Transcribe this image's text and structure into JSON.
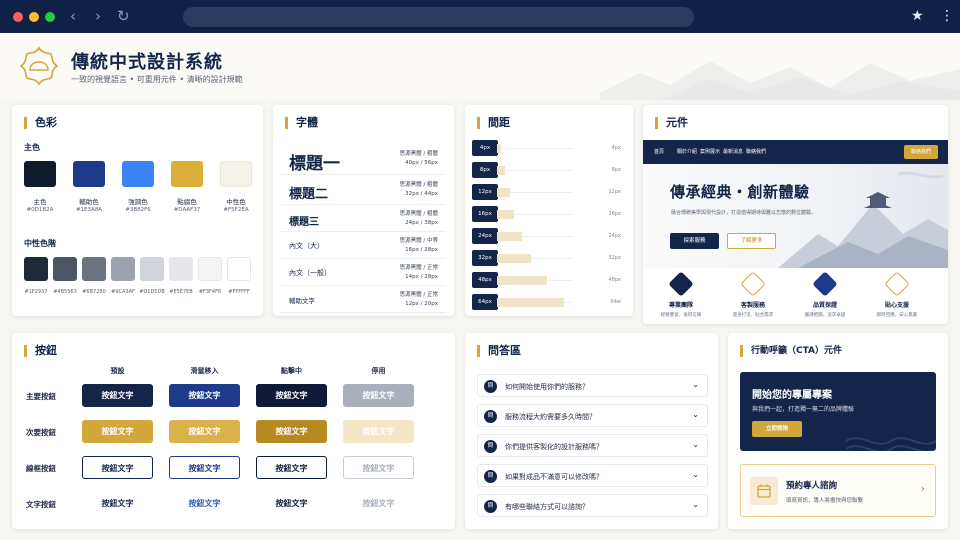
{
  "header": {
    "title": "傳統中式設計系統",
    "subtitle": "一致的視覺語言 • 可重用元件 • 清晰的設計規範"
  },
  "colors": {
    "title": "色彩",
    "primary_label": "主色",
    "primary": [
      {
        "name": "主色",
        "hex": "#0D1B2A"
      },
      {
        "name": "輔助色",
        "hex": "#1E3A8A"
      },
      {
        "name": "強調色",
        "hex": "#3B82F6"
      },
      {
        "name": "點綴色",
        "hex": "#DAAF37"
      },
      {
        "name": "中性色",
        "hex": "#F5F2EA"
      }
    ],
    "neutral_label": "中性色階",
    "neutrals": [
      "#1F2937",
      "#4B5563",
      "#6B7280",
      "#9CA3AF",
      "#D1D5DB",
      "#E5E7EB",
      "#F3F4F6",
      "#FFFFFF"
    ]
  },
  "typography": {
    "title": "字體",
    "rows": [
      {
        "sample": "標題一",
        "font": "思源黑體 / 粗體",
        "size": "40px / 56px"
      },
      {
        "sample": "標題二",
        "font": "思源黑體 / 粗體",
        "size": "32px / 44px"
      },
      {
        "sample": "標題三",
        "font": "思源黑體 / 粗體",
        "size": "24px / 38px"
      },
      {
        "sample": "內文（大）",
        "font": "思源黑體 / 中等",
        "size": "16px / 28px"
      },
      {
        "sample": "內文（一般）",
        "font": "思源黑體 / 正常",
        "size": "14px / 28px"
      },
      {
        "sample": "輔助文字",
        "font": "思源黑體 / 正常",
        "size": "12px / 20px"
      }
    ]
  },
  "spacing": {
    "title": "間距",
    "values": [
      4,
      8,
      12,
      16,
      24,
      32,
      48,
      64
    ],
    "labels": [
      "4px",
      "8px",
      "12px",
      "16px",
      "24px",
      "32px",
      "48px",
      "64px"
    ],
    "right_labels": [
      "4px",
      "8px",
      "12px",
      "16px",
      "24px",
      "32px",
      "48px",
      "64w"
    ]
  },
  "components": {
    "title": "元件",
    "nav_items": [
      "首頁",
      "關於介紹",
      "案例展示",
      "最新消息",
      "聯絡我們"
    ],
    "nav_button": "聯絡我們",
    "hero_title": "傳承經典・創新體驗",
    "hero_text": "融合傳統美學與現代設計，打造值得期待與難以忘懷的數位體驗。",
    "hero_btn_primary": "探索服務",
    "hero_btn_secondary": "了解更多",
    "features": [
      {
        "title": "專業團隊",
        "desc": "經驗豐富，值得信賴"
      },
      {
        "title": "客製服務",
        "desc": "量身打造，貼合需求"
      },
      {
        "title": "品質保證",
        "desc": "嚴謹把關，追求卓越"
      },
      {
        "title": "貼心支援",
        "desc": "即時回應，安心無憂"
      }
    ]
  },
  "buttons": {
    "title": "按鈕",
    "columns": [
      "預設",
      "滑鼠移入",
      "點擊中",
      "停用"
    ],
    "rows": [
      "主要按鈕",
      "次要按鈕",
      "線框按鈕",
      "文字按鈕"
    ],
    "label": "按鈕文字"
  },
  "faq": {
    "title": "問答區",
    "badge": "問",
    "items": [
      "如何開始使用你們的服務？",
      "服務流程大約需要多久時間？",
      "你們提供客製化的設計服務嗎？",
      "如果對成品不滿意可以修改嗎？",
      "有哪些聯絡方式可以諮詢？"
    ]
  },
  "cta": {
    "title": "行動呼籲（CTA）元件",
    "dark_title": "開始您的專屬專案",
    "dark_sub": "與我們一起，打造獨一無二的品牌體驗",
    "dark_button": "立即諮詢",
    "light_title": "預約專人諮詢",
    "light_sub": "填寫資訊，專人將盡快與您聯繫"
  }
}
